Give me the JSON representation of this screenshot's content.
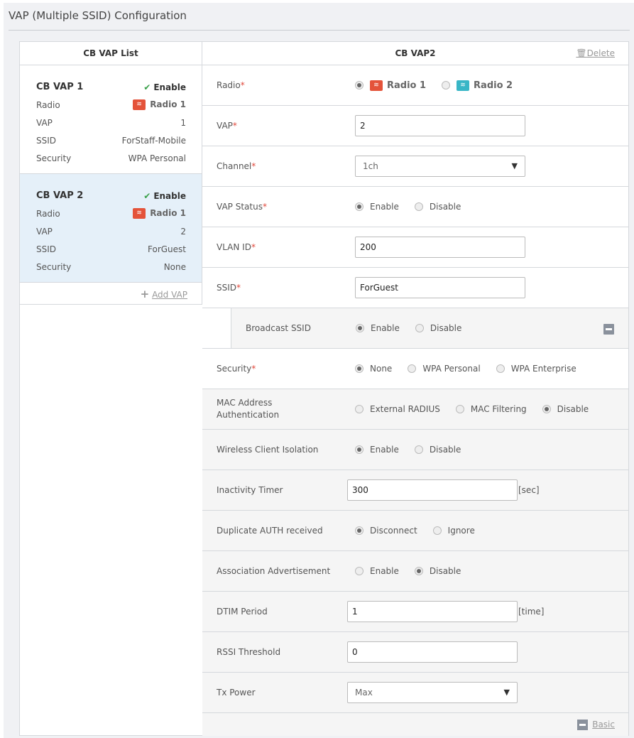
{
  "page_title": "VAP (Multiple SSID) Configuration",
  "list": {
    "title": "CB VAP List",
    "add_label": "Add VAP",
    "items": [
      {
        "name": "CB VAP 1",
        "status": "Enable",
        "radio_label": "Radio",
        "radio": "Radio 1",
        "vap_label": "VAP",
        "vap": "1",
        "ssid_label": "SSID",
        "ssid": "ForStaff-Mobile",
        "security_label": "Security",
        "security": "WPA Personal"
      },
      {
        "name": "CB VAP 2",
        "status": "Enable",
        "radio_label": "Radio",
        "radio": "Radio 1",
        "vap_label": "VAP",
        "vap": "2",
        "ssid_label": "SSID",
        "ssid": "ForGuest",
        "security_label": "Security",
        "security": "None"
      }
    ]
  },
  "detail": {
    "title": "CB VAP2",
    "delete_label": "Delete",
    "basic_label": "Basic",
    "radio": {
      "label": "Radio",
      "options": [
        "Radio 1",
        "Radio 2"
      ]
    },
    "vap": {
      "label": "VAP",
      "value": "2"
    },
    "channel": {
      "label": "Channel",
      "value": "1ch"
    },
    "vap_status": {
      "label": "VAP Status",
      "options": [
        "Enable",
        "Disable"
      ]
    },
    "vlan": {
      "label": "VLAN ID",
      "value": "200"
    },
    "ssid": {
      "label": "SSID",
      "value": "ForGuest"
    },
    "broadcast": {
      "label": "Broadcast SSID",
      "options": [
        "Enable",
        "Disable"
      ]
    },
    "security": {
      "label": "Security",
      "options": [
        "None",
        "WPA Personal",
        "WPA Enterprise"
      ]
    },
    "mac_auth": {
      "label1": "MAC Address",
      "label2": "Authentication",
      "options": [
        "External RADIUS",
        "MAC Filtering",
        "Disable"
      ]
    },
    "isolation": {
      "label": "Wireless Client Isolation",
      "options": [
        "Enable",
        "Disable"
      ]
    },
    "inactivity": {
      "label": "Inactivity Timer",
      "value": "300",
      "unit": "[sec]"
    },
    "dup_auth": {
      "label": "Duplicate AUTH received",
      "options": [
        "Disconnect",
        "Ignore"
      ]
    },
    "assoc_adv": {
      "label": "Association Advertisement",
      "options": [
        "Enable",
        "Disable"
      ]
    },
    "dtim": {
      "label": "DTIM Period",
      "value": "1",
      "unit": "[time]"
    },
    "rssi": {
      "label": "RSSI Threshold",
      "value": "0"
    },
    "tx_power": {
      "label": "Tx Power",
      "value": "Max"
    }
  },
  "required_mark": "*"
}
